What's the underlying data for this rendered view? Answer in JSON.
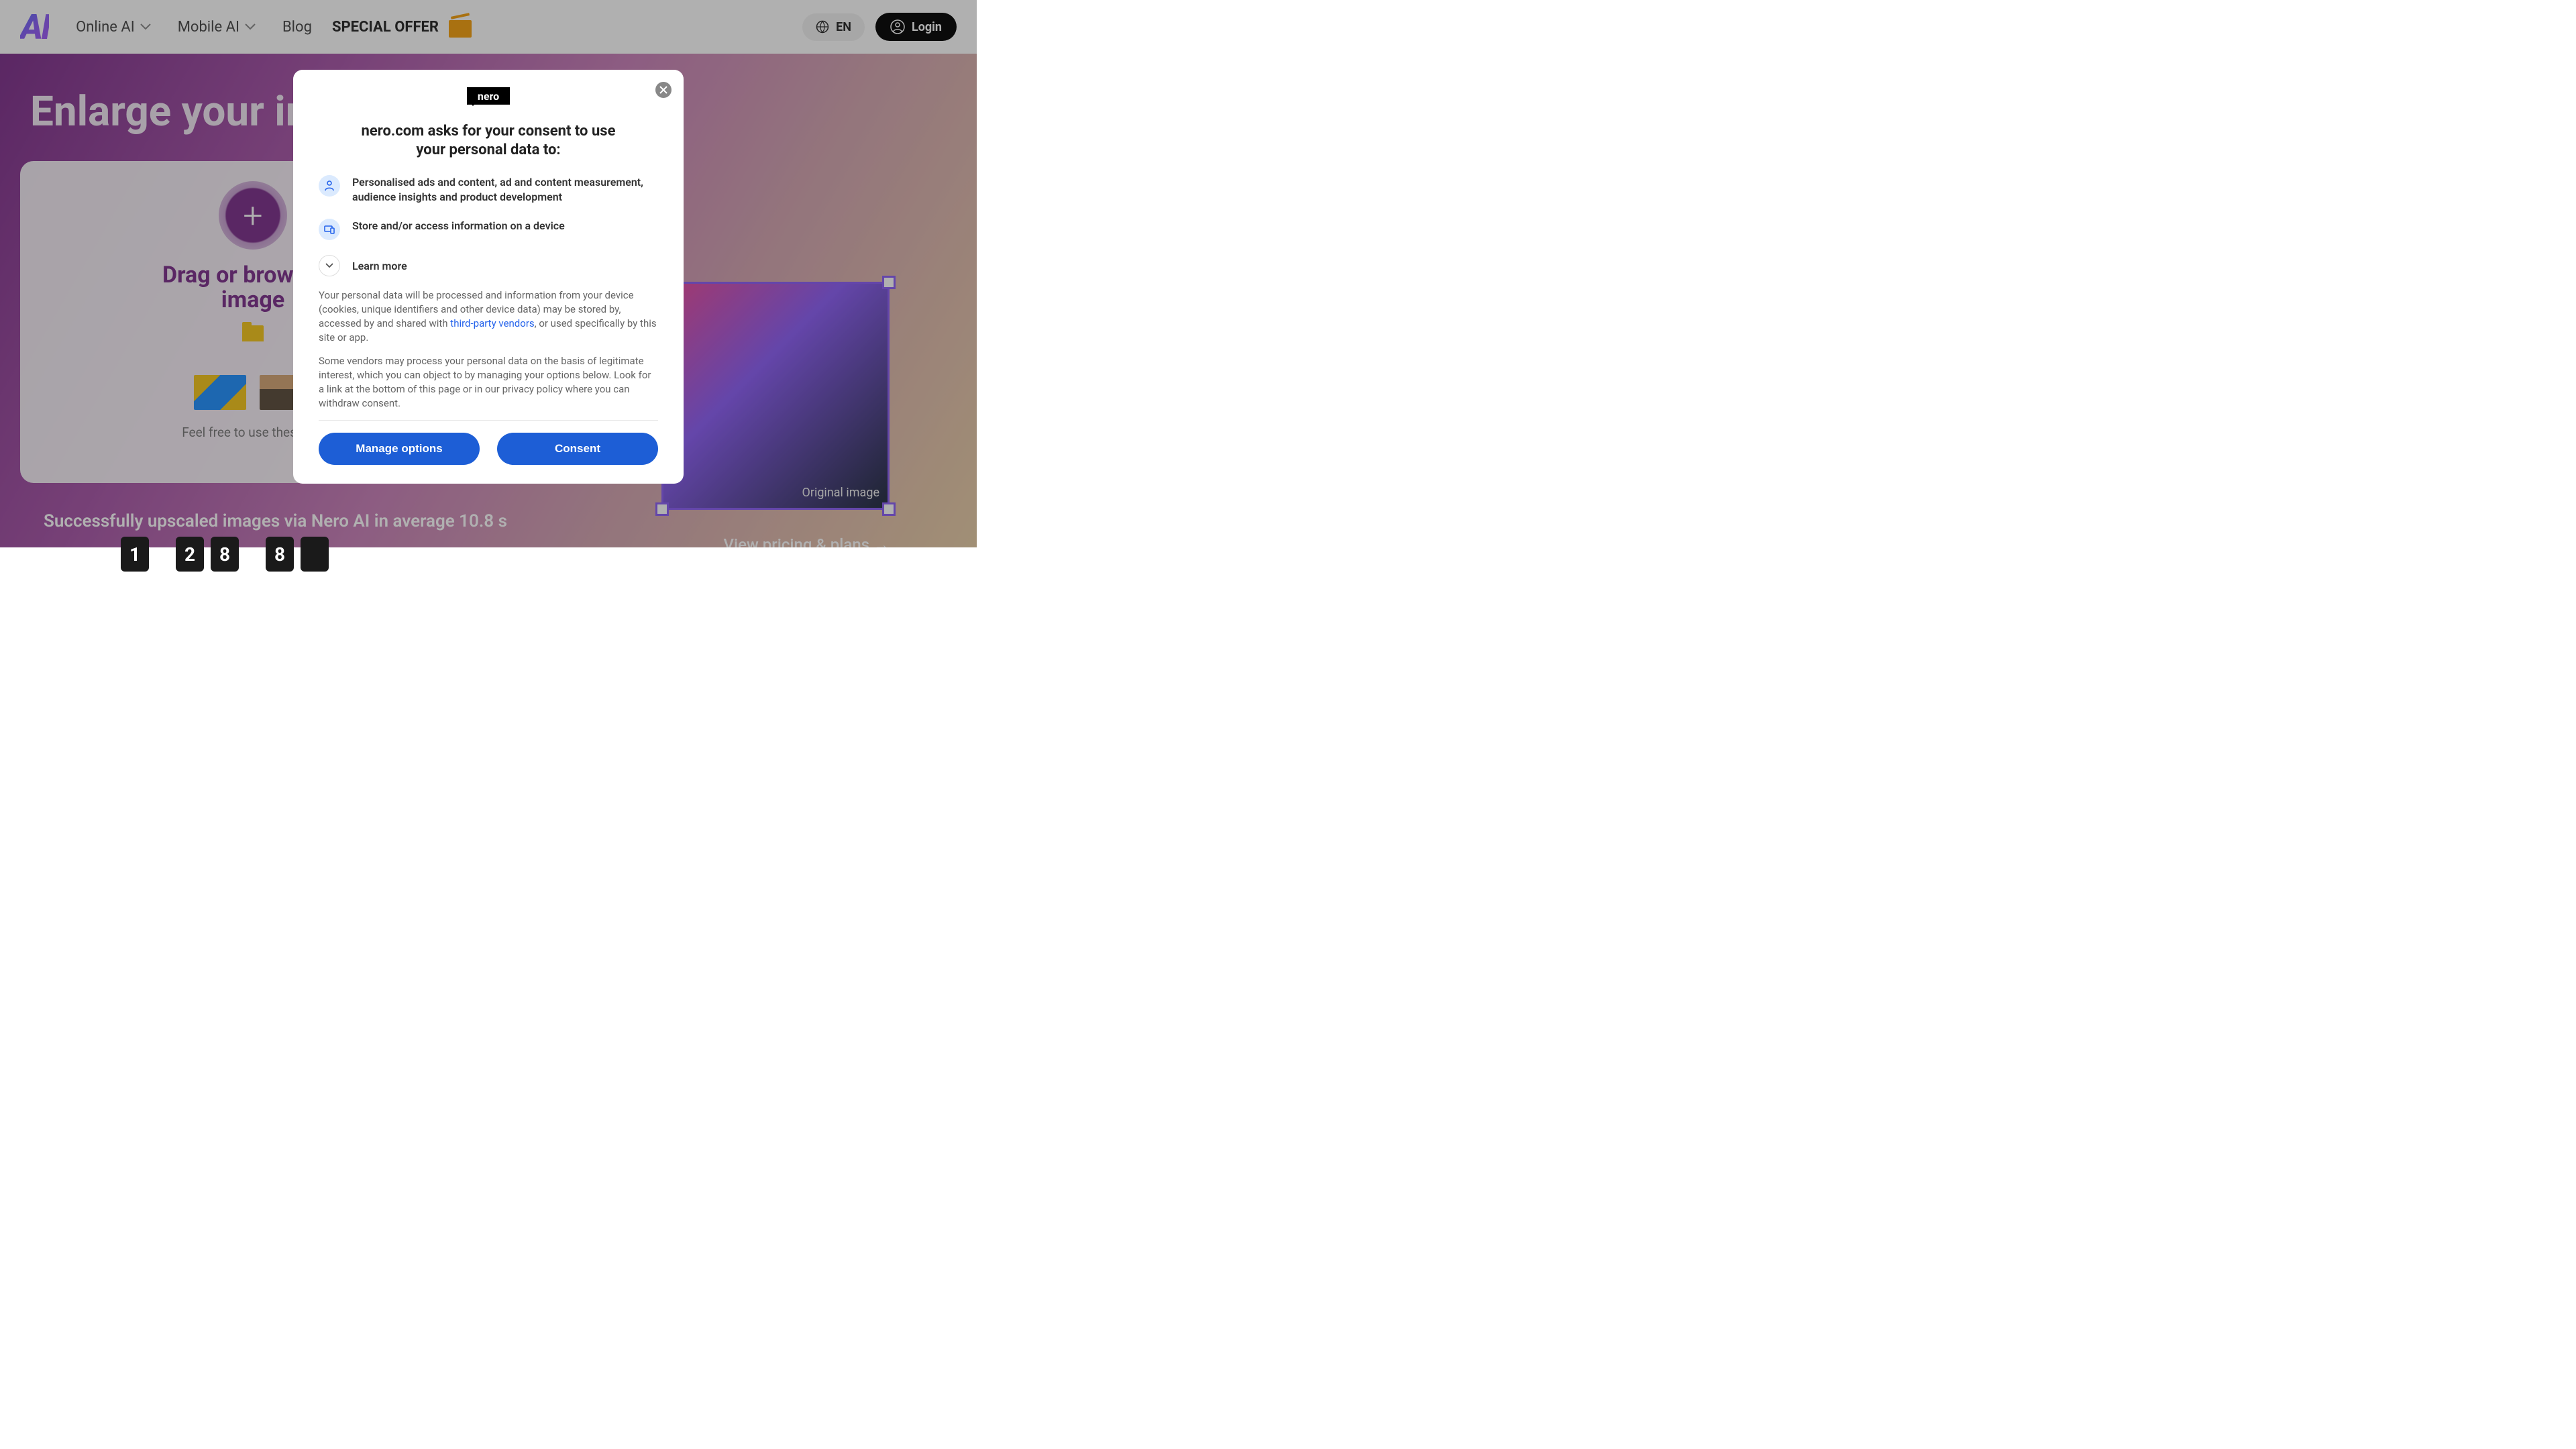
{
  "header": {
    "logo_text": "AI",
    "nav": {
      "online_ai": "Online AI",
      "mobile_ai": "Mobile AI",
      "blog": "Blog",
      "special_offer": "SPECIAL OFFER"
    },
    "language": "EN",
    "login": "Login"
  },
  "hero": {
    "title": "Enlarge your im",
    "upload_heading": "Drag or browse to",
    "upload_heading_line2": "image",
    "feel_free": "Feel free to use these tes",
    "upscaled_text": "Successfully upscaled images via Nero AI in average 10.8 s",
    "counter_digits": [
      "1",
      "2",
      "8",
      "8"
    ],
    "view_pricing": "View pricing & plans →",
    "original_label": "Original image"
  },
  "modal": {
    "brand": "nero",
    "title": "nero.com asks for your consent to use your personal data to:",
    "item1": "Personalised ads and content, ad and content measurement, audience insights and product development",
    "item2": "Store and/or access information on a device",
    "learn_more": "Learn more",
    "para1_pre": "Your personal data will be processed and information from your device (cookies, unique identifiers and other device data) may be stored by, accessed by and shared with ",
    "para1_link": "third-party vendors",
    "para1_post": ", or used specifically by this site or app.",
    "para2": "Some vendors may process your personal data on the basis of legitimate interest, which you can object to by managing your options below. Look for a link at the bottom of this page or in our privacy policy where you can withdraw consent.",
    "manage_button": "Manage options",
    "consent_button": "Consent"
  }
}
